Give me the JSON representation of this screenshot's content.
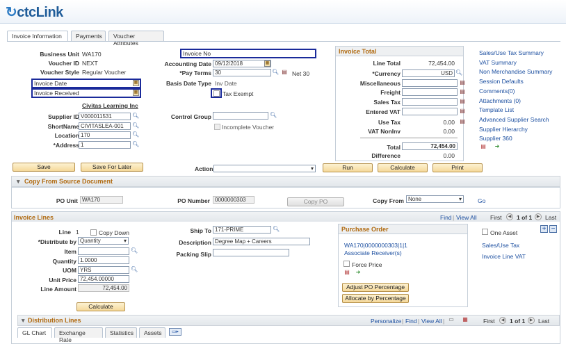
{
  "app": {
    "logo": "ctcLink"
  },
  "tabs": [
    "Invoice Information",
    "Payments",
    "Voucher Attributes"
  ],
  "header": {
    "business_unit_label": "Business Unit",
    "business_unit": "WA170",
    "voucher_id_label": "Voucher ID",
    "voucher_id": "NEXT",
    "voucher_style_label": "Voucher Style",
    "voucher_style": "Regular Voucher",
    "invoice_date_label": "Invoice Date",
    "invoice_received_label": "Invoice Received",
    "vendor_name": "Civitas Learning Inc",
    "supplier_id_label": "Supplier ID",
    "supplier_id": "V000011531",
    "shortname_label": "ShortName",
    "shortname": "CIVITASLEA-001",
    "location_label": "Location",
    "location": "170",
    "address_label": "*Address",
    "address": "1",
    "invoice_no_label": "Invoice No",
    "accounting_date_label": "Accounting Date",
    "accounting_date": "09/12/2018",
    "pay_terms_label": "*Pay Terms",
    "pay_terms": "30",
    "pay_terms_desc": "Net 30",
    "basis_date_type_label": "Basis Date Type",
    "basis_date_type": "Inv Date",
    "tax_exempt_label": "Tax Exempt",
    "control_group_label": "Control Group",
    "incomplete_voucher_label": "Incomplete Voucher"
  },
  "invoice_total": {
    "title": "Invoice Total",
    "line_total_label": "Line Total",
    "line_total": "72,454.00",
    "currency_label": "*Currency",
    "currency": "USD",
    "misc_label": "Miscellaneous",
    "freight_label": "Freight",
    "sales_tax_label": "Sales Tax",
    "entered_vat_label": "Entered VAT",
    "use_tax_label": "Use Tax",
    "use_tax": "0.00",
    "vat_nonrv_label": "VAT NonInv",
    "vat_nonrv": "0.00",
    "total_label": "Total",
    "total": "72,454.00",
    "difference_label": "Difference",
    "difference": "0.00"
  },
  "side_links": [
    "Sales/Use Tax Summary",
    "VAT Summary",
    "Non Merchandise Summary",
    "Session Defaults",
    "Comments(0)",
    "Attachments (0)",
    "Template List",
    "Advanced Supplier Search",
    "Supplier Hierarchy",
    "Supplier 360"
  ],
  "buttons": {
    "save": "Save",
    "save_later": "Save For Later",
    "run": "Run",
    "calculate": "Calculate",
    "print": "Print",
    "copy_po": "Copy PO",
    "line_calculate": "Calculate",
    "adjust_po": "Adjust PO Percentage",
    "allocate": "Allocate by Percentage"
  },
  "action_label": "Action",
  "copy_section": {
    "title": "Copy From Source Document",
    "po_unit_label": "PO Unit",
    "po_unit": "WA170",
    "po_number_label": "PO Number",
    "po_number": "0000000303",
    "copy_from_label": "Copy From",
    "copy_from": "None",
    "go": "Go"
  },
  "invoice_lines": {
    "title": "Invoice Lines",
    "find": "Find",
    "view_all": "View All",
    "first": "First",
    "count": "1 of 1",
    "last": "Last",
    "line_label": "Line",
    "line": "1",
    "copy_down": "Copy Down",
    "distribute_label": "*Distribute by",
    "distribute": "Quantity",
    "item_label": "Item",
    "quantity_label": "Quantity",
    "quantity": "1.0000",
    "uom_label": "UOM",
    "uom": "YRS",
    "unit_price_label": "Unit Price",
    "unit_price": "72,454.00000",
    "line_amount_label": "Line Amount",
    "line_amount": "72,454.00",
    "ship_to_label": "Ship To",
    "ship_to": "171-PRIME",
    "description_label": "Description",
    "description": "Degree Map + Careers",
    "packing_slip_label": "Packing Slip",
    "po_title": "Purchase Order",
    "po_ref": "WA170|0000000303|1|1",
    "assoc_receivers": "Associate Receiver(s)",
    "force_price": "Force Price",
    "one_asset": "One Asset",
    "sales_use_tax": "Sales/Use Tax",
    "line_vat": "Invoice Line VAT"
  },
  "dist_lines": {
    "title": "Distribution Lines",
    "personalize": "Personalize",
    "find": "Find",
    "view_all": "View All",
    "first": "First",
    "count": "1 of 1",
    "last": "Last",
    "tabs": [
      "GL Chart",
      "Exchange Rate",
      "Statistics",
      "Assets"
    ]
  }
}
